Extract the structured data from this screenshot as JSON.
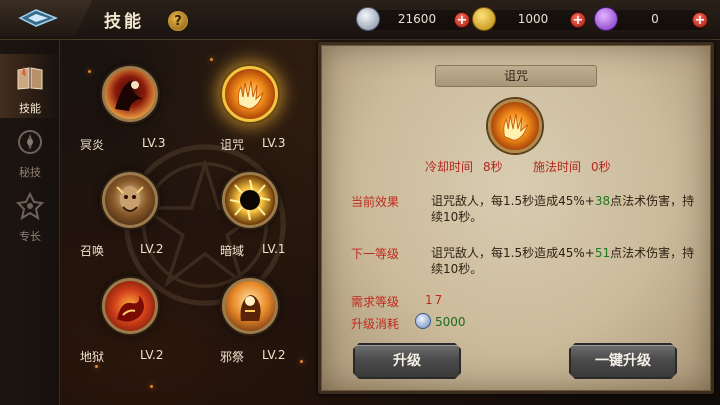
{
  "header": {
    "title": "技能",
    "help_label": "?",
    "currencies": [
      {
        "name": "silver-coin-icon",
        "value": "21600",
        "plus": "+"
      },
      {
        "name": "gold-coin-icon",
        "value": "1000",
        "plus": "+"
      },
      {
        "name": "purple-gem-icon",
        "value": "0",
        "plus": "+"
      }
    ]
  },
  "sidebar": {
    "items": [
      {
        "label": "技能",
        "icon": "book-icon",
        "active": true
      },
      {
        "label": "秘技",
        "icon": "secret-skill-icon",
        "active": false
      },
      {
        "label": "专长",
        "icon": "specialty-icon",
        "active": false
      }
    ]
  },
  "skills": [
    {
      "name": "冥炎",
      "level": "LV.3"
    },
    {
      "name": "诅咒",
      "level": "LV.3"
    },
    {
      "name": "召唤",
      "level": "LV.2"
    },
    {
      "name": "暗域",
      "level": "LV.1"
    },
    {
      "name": "地狱",
      "level": "LV.2"
    },
    {
      "name": "邪祭",
      "level": "LV.2"
    }
  ],
  "detail": {
    "title": "诅咒",
    "cooldown_label": "冷却时间",
    "cooldown_value": "8秒",
    "cast_label": "施法时间",
    "cast_value": "0秒",
    "current_label": "当前效果",
    "current_pre": "诅咒敌人，每1.5秒造成45%+",
    "current_num": "38",
    "current_post": "点法术伤害，持续10秒。",
    "next_label": "下一等级",
    "next_pre": "诅咒敌人，每1.5秒造成45%+",
    "next_num": "51",
    "next_post": "点法术伤害，持续10秒。",
    "req_label": "需求等级",
    "req_value": "17",
    "cost_label": "升级消耗",
    "cost_value": "5000",
    "upgrade_label": "升级",
    "upgrade_all_label": "一键升级"
  },
  "colors": {
    "accent_gold": "#f5c542",
    "label_red": "#c02a1e",
    "value_green": "#1e7a1e",
    "parchment": "#d9ccb1"
  }
}
